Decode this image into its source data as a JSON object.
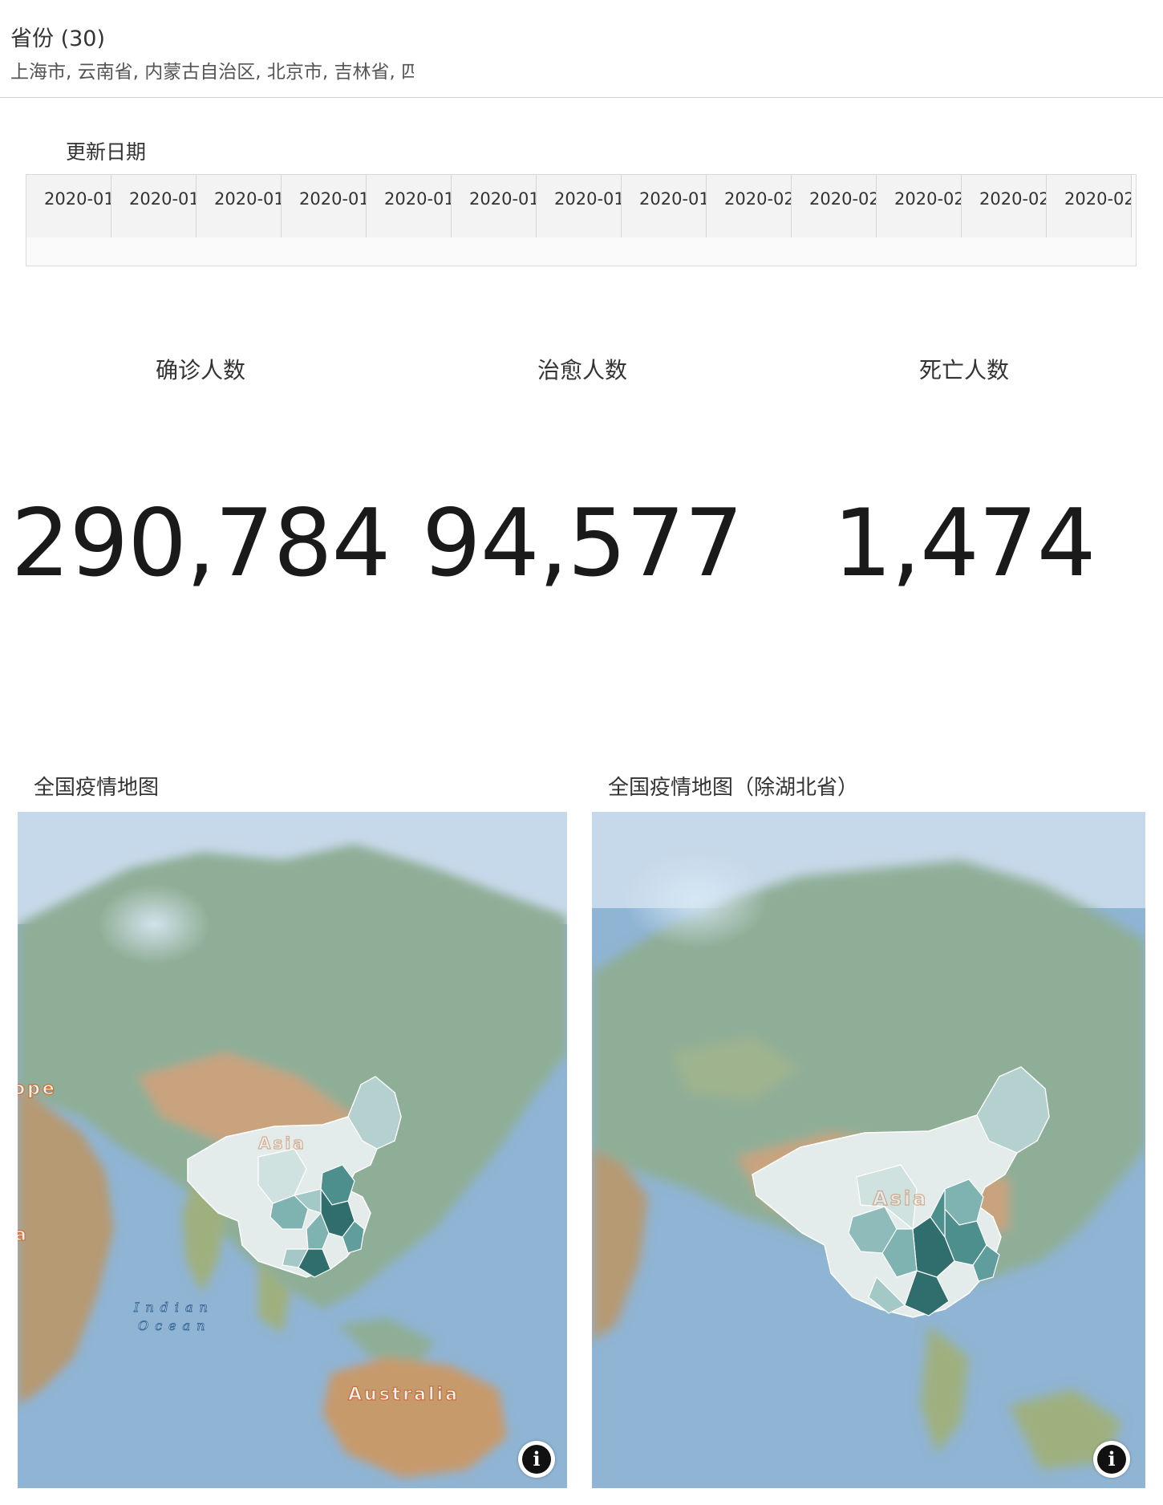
{
  "filter": {
    "title": "省份 (30)",
    "value": "上海市, 云南省, 内蒙古自治区, 北京市, 吉林省, 四川省"
  },
  "date_filter": {
    "label": "更新日期",
    "items": [
      "2020-01",
      "2020-01",
      "2020-01",
      "2020-01",
      "2020-01",
      "2020-01",
      "2020-01",
      "2020-01",
      "2020-02",
      "2020-02",
      "2020-02",
      "2020-02",
      "2020-02"
    ]
  },
  "kpis": [
    {
      "label": "确诊人数",
      "value": "290,784"
    },
    {
      "label": "治愈人数",
      "value": "94,577"
    },
    {
      "label": "死亡人数",
      "value": "1,474"
    }
  ],
  "maps": {
    "left": {
      "title": "全国疫情地图",
      "labels": {
        "europe": "ope",
        "africa": "a",
        "asia": "Asia",
        "ocean_line1": "Indian",
        "ocean_line2": "Ocean",
        "australia": "Australia"
      }
    },
    "right": {
      "title": "全国疫情地图（除湖北省）",
      "labels": {
        "asia": "Asia"
      }
    },
    "info_icon": "i",
    "colors": {
      "sea": "#8fb4d4",
      "land": "#8fae97",
      "desert": "#c9a37e",
      "china_light": "#e3ecea",
      "china_mid": "#7fb3b1",
      "china_dark": "#2f6e6c"
    }
  }
}
